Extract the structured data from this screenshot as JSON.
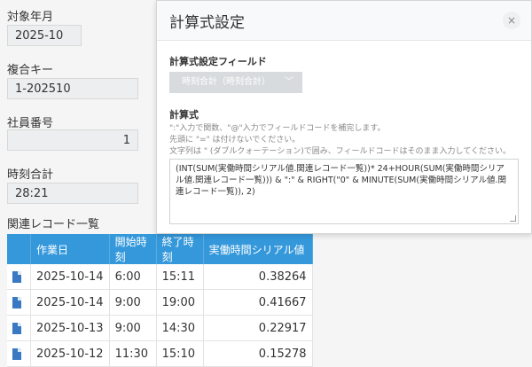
{
  "form": {
    "fields": [
      {
        "label": "対象年月",
        "value": "2025-10"
      },
      {
        "label": "複合キー",
        "value": "1-202510"
      },
      {
        "label": "社員番号",
        "value": "1"
      },
      {
        "label": "時刻合計",
        "value": "28:21"
      }
    ],
    "related_label": "関連レコード一覧"
  },
  "table": {
    "headers": [
      "作業日",
      "開始時刻",
      "終了時刻",
      "実働時間シリアル値"
    ],
    "rows": [
      [
        "2025-10-14",
        "6:00",
        "15:11",
        "0.38264"
      ],
      [
        "2025-10-14",
        "9:00",
        "19:00",
        "0.41667"
      ],
      [
        "2025-10-13",
        "9:00",
        "14:30",
        "0.22917"
      ],
      [
        "2025-10-12",
        "11:30",
        "15:10",
        "0.15278"
      ]
    ]
  },
  "modal": {
    "title": "計算式設定",
    "close_icon": "×",
    "field_section_label": "計算式設定フィールド",
    "field_select_value": "時刻合計（時刻合計）",
    "formula_section_label": "計算式",
    "help_lines": [
      "\":\"入力で関数、\"@\"入力でフィールドコードを補完します。",
      "先頭に \"=\" は付けないでください。",
      "文字列は \" (ダブルクォーテーション)で囲み、フィールドコードはそのまま入力してください。"
    ],
    "formula": "(INT(SUM(実働時間シリアル値.関連レコード一覧))* 24+HOUR(SUM(実働時間シリアル値.関連レコード一覧))) & \":\" & RIGHT(\"0\" & MINUTE(SUM(実働時間シリアル値.関連レコード一覧)), 2)"
  },
  "colors": {
    "table_header": "#3498db",
    "doc_icon": "#3a78c4"
  }
}
